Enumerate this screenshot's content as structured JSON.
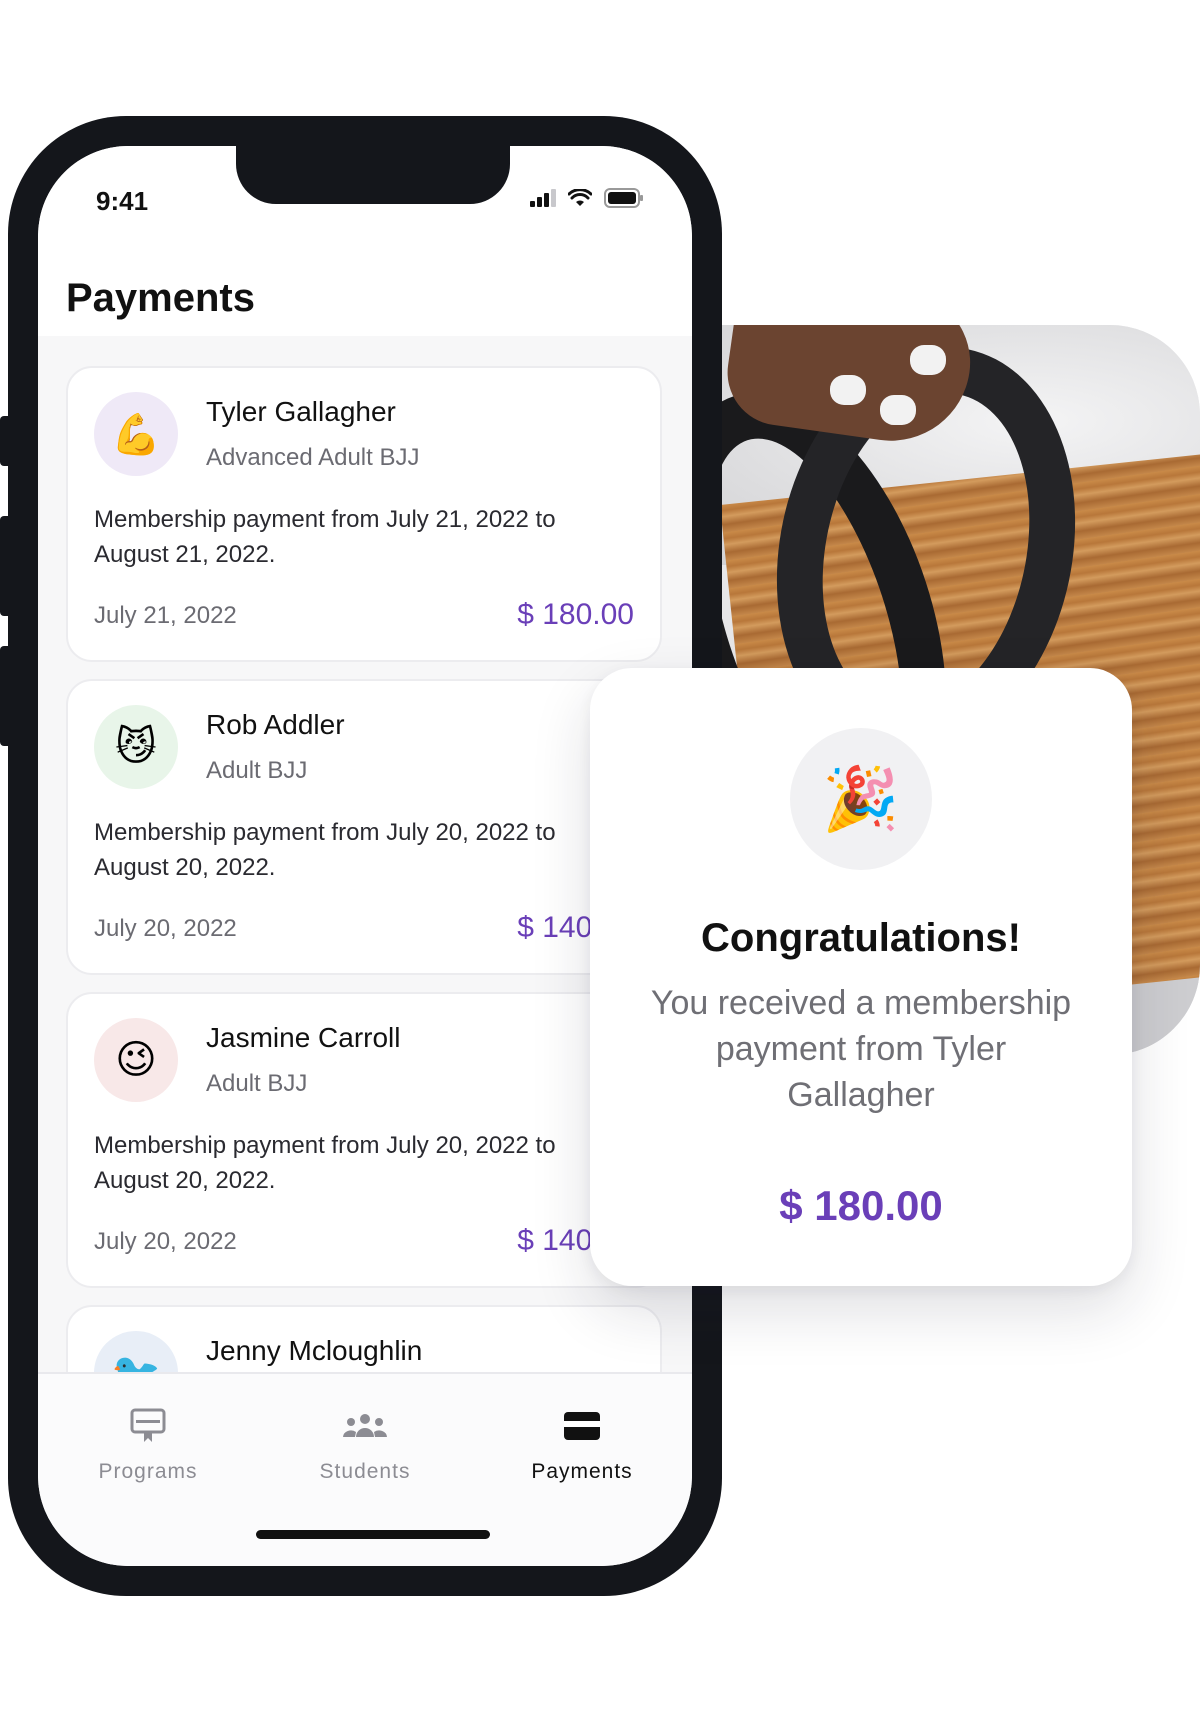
{
  "status_bar": {
    "time": "9:41"
  },
  "header": {
    "title": "Payments"
  },
  "payments": [
    {
      "name": "Tyler Gallagher",
      "program": "Advanced Adult BJJ",
      "description": "Membership payment from July 21, 2022 to August 21, 2022.",
      "date": "July 21, 2022",
      "amount": "$ 180.00",
      "avatar_icon": "💪",
      "avatar_bg": "#efe9f7"
    },
    {
      "name": "Rob Addler",
      "program": "Adult BJJ",
      "description": "Membership payment from July 20, 2022 to August 20, 2022.",
      "date": "July 20, 2022",
      "amount": "$ 140.00",
      "avatar_icon": "😼",
      "avatar_bg": "#e8f5e9"
    },
    {
      "name": "Jasmine Carroll",
      "program": "Adult BJJ",
      "description": "Membership payment from July 20, 2022 to August 20, 2022.",
      "date": "July 20, 2022",
      "amount": "$ 140.00",
      "avatar_icon": "😉",
      "avatar_bg": "#f8e8e8"
    },
    {
      "name": "Jenny Mcloughlin",
      "program": "",
      "description": "",
      "date": "",
      "amount": "",
      "avatar_icon": "🐦",
      "avatar_bg": "#e8eef7"
    }
  ],
  "tabs": [
    {
      "label": "Programs",
      "icon": "programs-icon",
      "active": false
    },
    {
      "label": "Students",
      "icon": "students-icon",
      "active": false
    },
    {
      "label": "Payments",
      "icon": "payments-icon",
      "active": true
    }
  ],
  "notification": {
    "icon": "🎉",
    "title": "Congratulations!",
    "message": "You received a membership payment from Tyler Gallagher",
    "amount": "$ 180.00"
  },
  "colors": {
    "accent": "#6a3fb8",
    "phone_frame": "#14161b"
  }
}
